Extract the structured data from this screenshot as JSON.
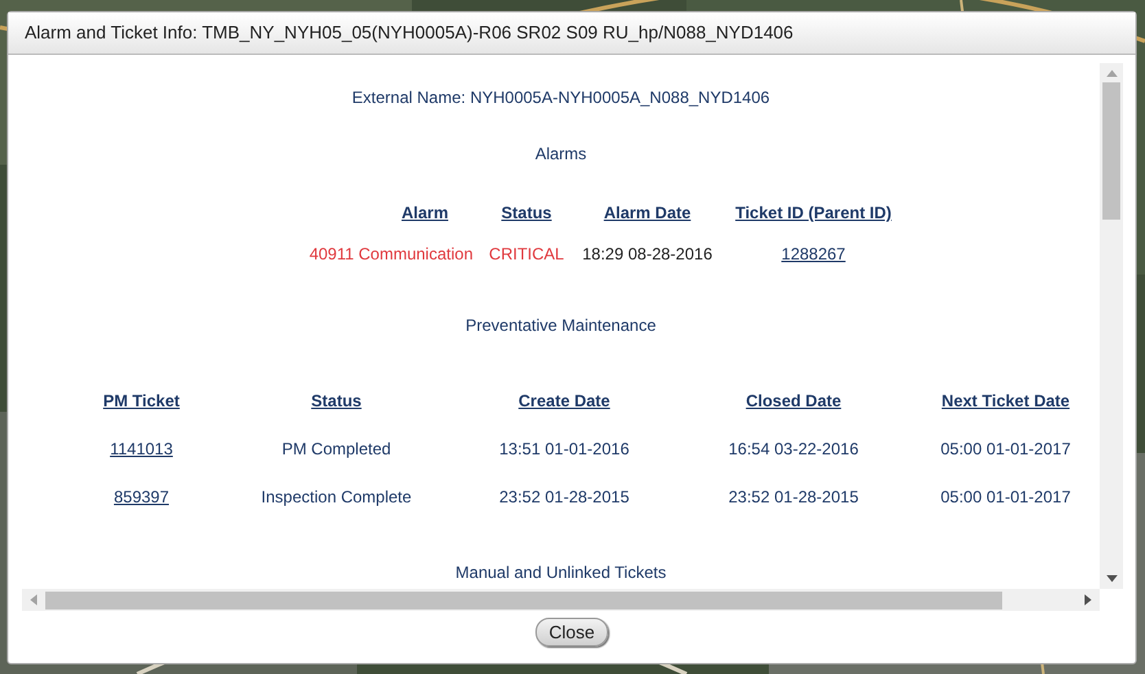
{
  "dialog": {
    "title": "Alarm and Ticket Info: TMB_NY_NYH05_05(NYH0005A)-R06 SR02 S09 RU_hp/N088_NYD1406"
  },
  "external_name": "External Name: NYH0005A-NYH0005A_N088_NYD1406",
  "alarms": {
    "heading": "Alarms",
    "columns": [
      "Alarm",
      "Status",
      "Alarm Date",
      "Ticket ID (Parent ID)"
    ],
    "rows": [
      {
        "alarm": "40911 Communication",
        "status": "CRITICAL",
        "date": "18:29 08-28-2016",
        "ticket": "1288267"
      }
    ]
  },
  "pm": {
    "heading": "Preventative Maintenance",
    "columns": [
      "PM Ticket",
      "Status",
      "Create Date",
      "Closed Date",
      "Next Ticket Date"
    ],
    "rows": [
      [
        "1141013",
        "PM Completed",
        "13:51 01-01-2016",
        "16:54 03-22-2016",
        "05:00 01-01-2017"
      ],
      [
        "859397",
        "Inspection Complete",
        "23:52 01-28-2015",
        "23:52 01-28-2015",
        "05:00 01-01-2017"
      ]
    ]
  },
  "manual_heading": "Manual and Unlinked Tickets",
  "buttons": [
    "Close"
  ]
}
